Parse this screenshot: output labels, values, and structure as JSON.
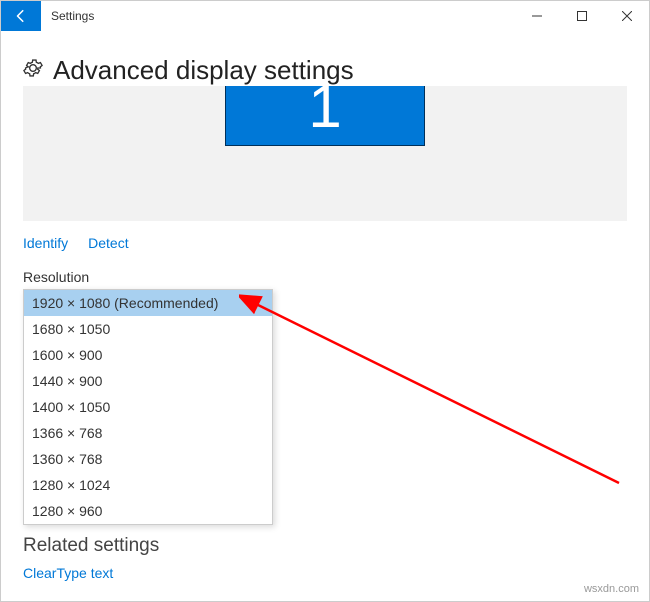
{
  "titlebar": {
    "title": "Settings"
  },
  "page": {
    "heading": "Advanced display settings"
  },
  "display_tile": {
    "number": "1"
  },
  "links": {
    "identify": "Identify",
    "detect": "Detect"
  },
  "resolution": {
    "label": "Resolution",
    "options": [
      "1920 × 1080 (Recommended)",
      "1680 × 1050",
      "1600 × 900",
      "1440 × 900",
      "1400 × 1050",
      "1366 × 768",
      "1360 × 768",
      "1280 × 1024",
      "1280 × 960"
    ],
    "selected_index": 0
  },
  "related": {
    "heading": "Related settings",
    "cleartype": "ClearType text"
  },
  "watermark": "wsxdn.com"
}
